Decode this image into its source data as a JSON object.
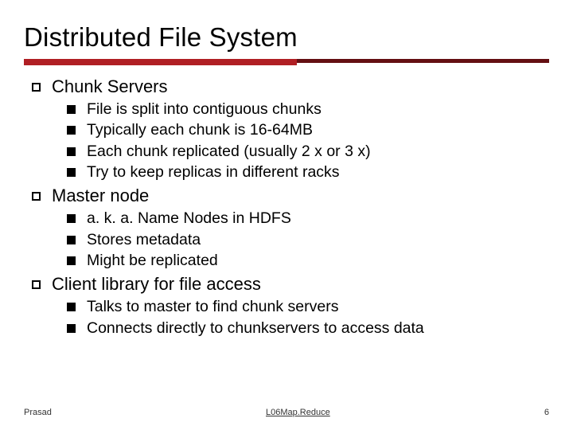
{
  "title": "Distributed File System",
  "sections": [
    {
      "heading": "Chunk Servers",
      "items": [
        "File is split into contiguous chunks",
        "Typically each chunk is 16-64MB",
        "Each chunk replicated (usually 2 x or 3 x)",
        "Try to keep replicas in different racks"
      ]
    },
    {
      "heading": "Master node",
      "items": [
        "a. k. a. Name Nodes in HDFS",
        "Stores metadata",
        "Might be replicated"
      ]
    },
    {
      "heading": "Client library for file access",
      "items": [
        "Talks to master to find chunk servers",
        "Connects directly to chunkservers to access data"
      ]
    }
  ],
  "footer": {
    "author": "Prasad",
    "lecture": "L06Map.Reduce",
    "page": "6"
  }
}
